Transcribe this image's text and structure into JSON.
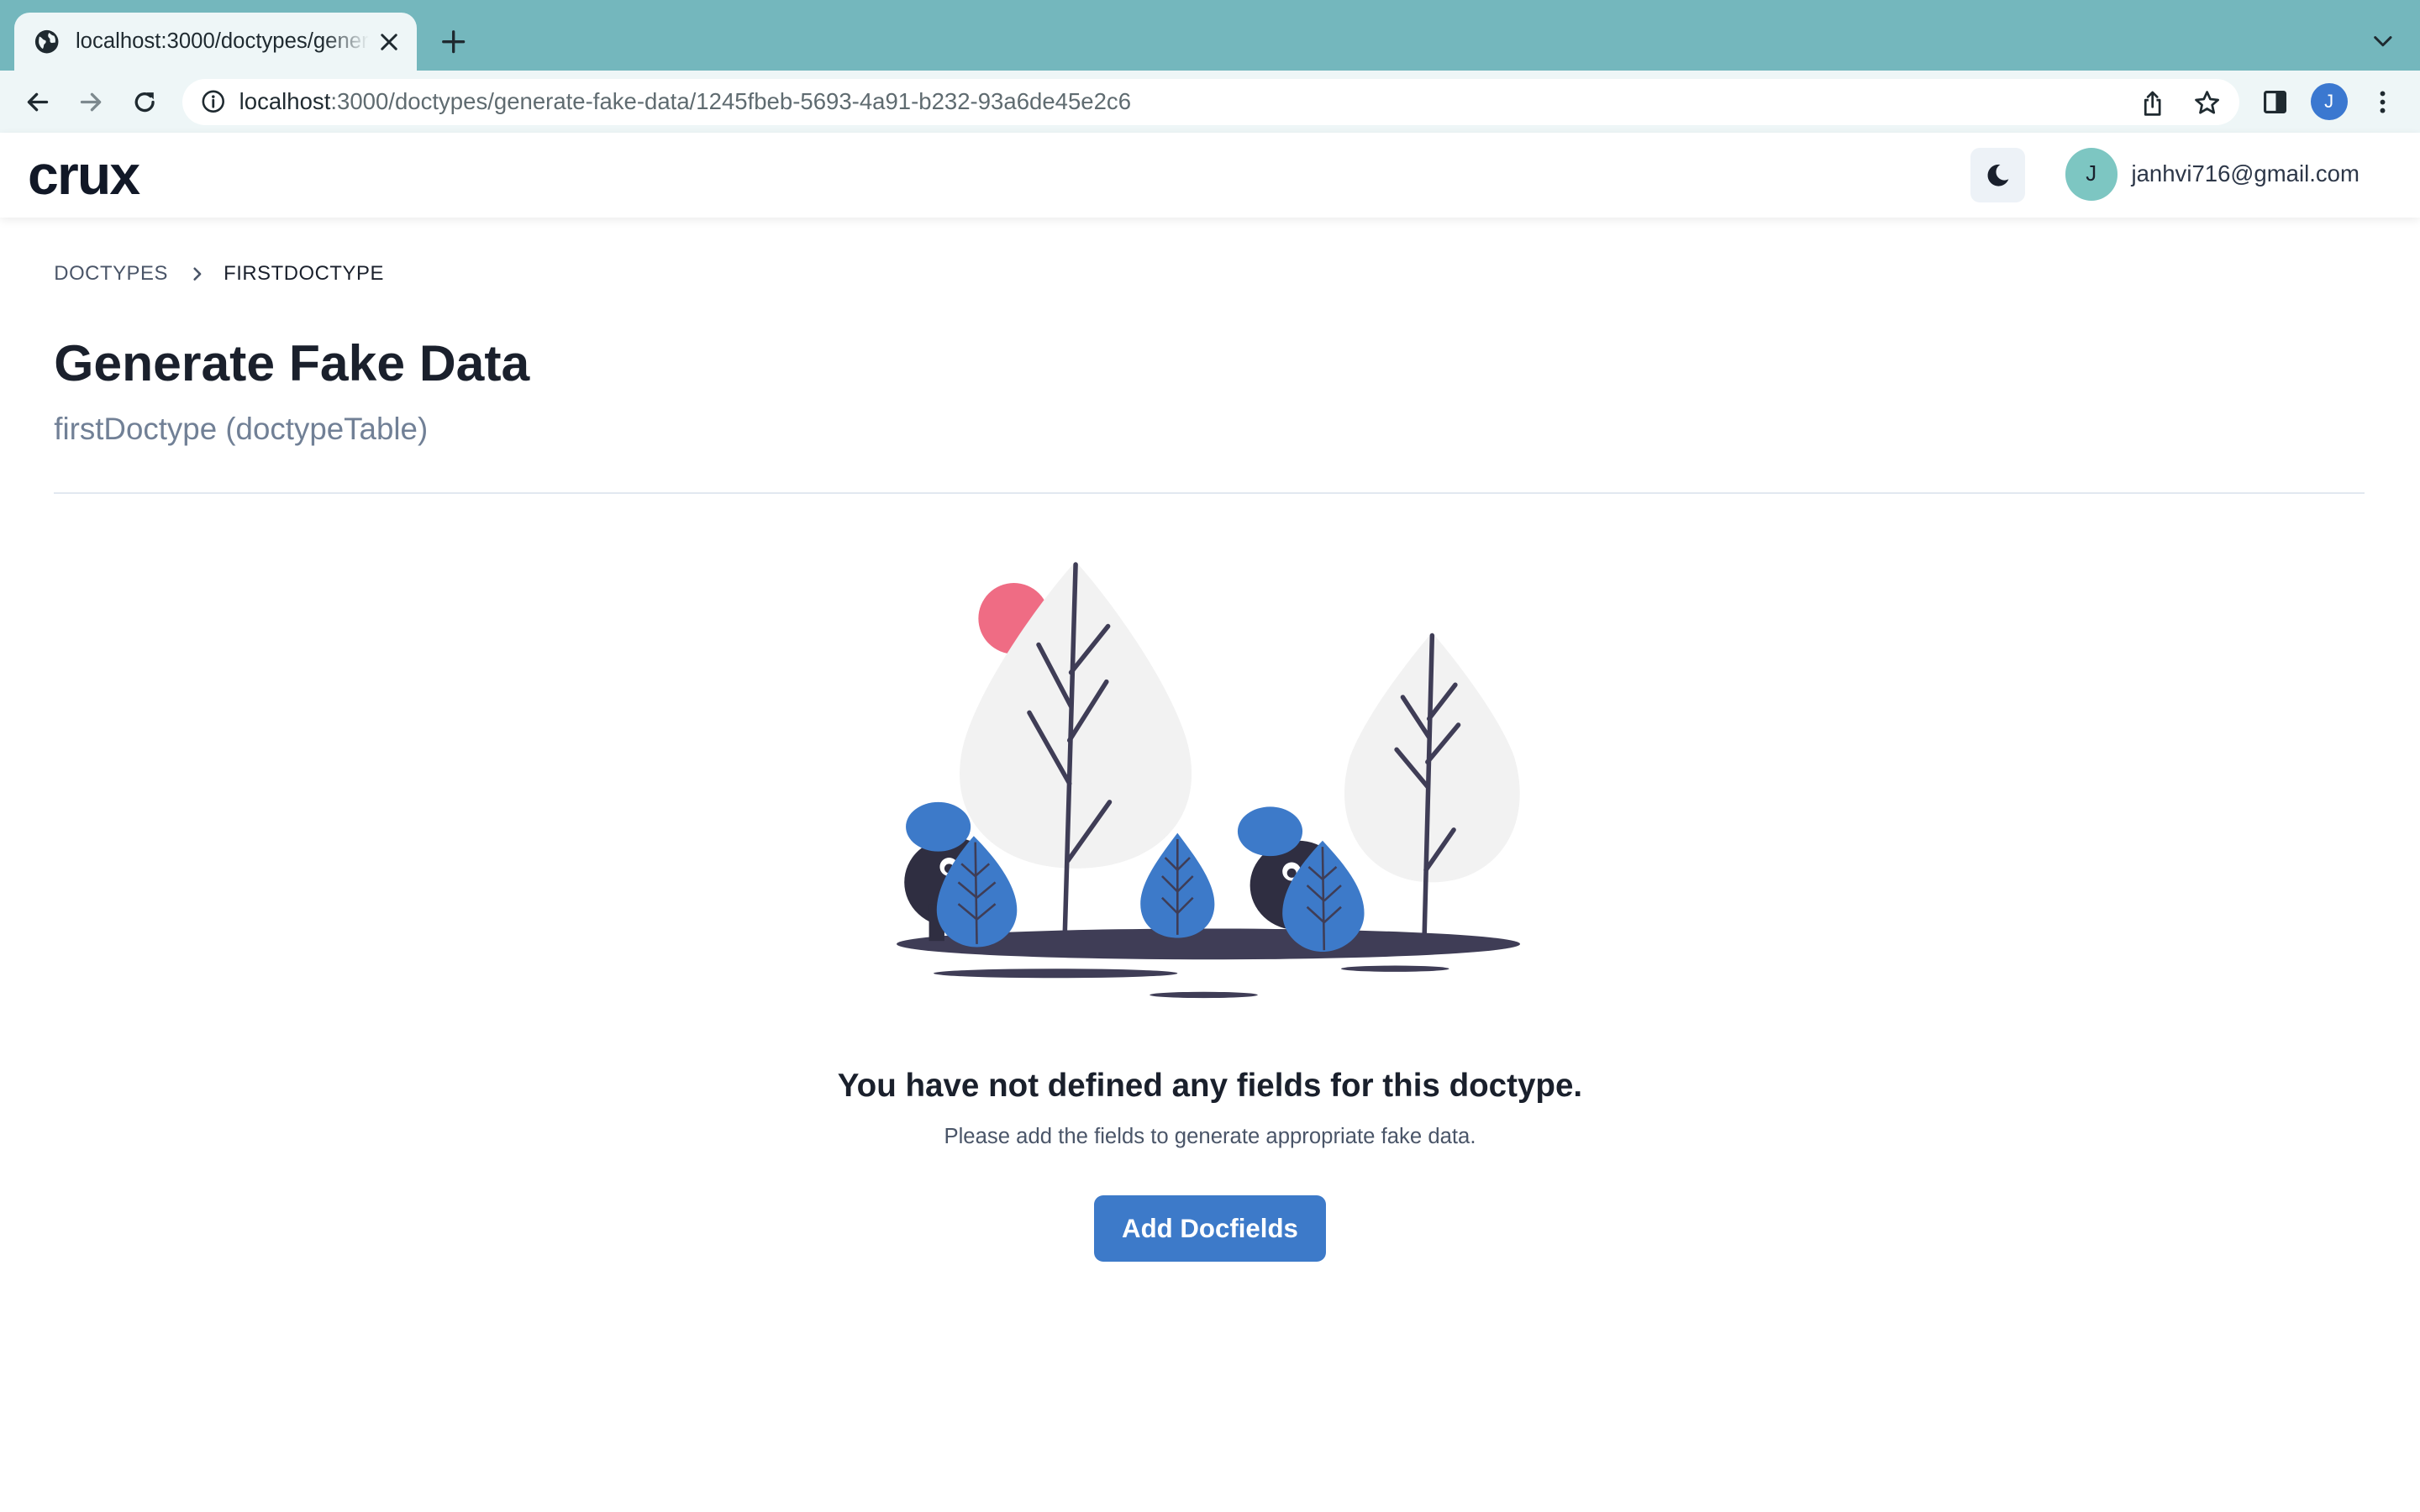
{
  "browser": {
    "tab_title": "localhost:3000/doctypes/generate-fake-data/1245fbeb-5693-4a91-b232-93a6de45e2c6",
    "url_host": "localhost",
    "url_rest": ":3000/doctypes/generate-fake-data/1245fbeb-5693-4a91-b232-93a6de45e2c6",
    "profile_initial": "J"
  },
  "header": {
    "logo": "crux",
    "user_initial": "J",
    "user_email": "janhvi716@gmail.com"
  },
  "breadcrumb": {
    "items": [
      "DOCTYPES",
      "FIRSTDOCTYPE"
    ]
  },
  "page": {
    "title": "Generate Fake Data",
    "subtitle": "firstDoctype (doctypeTable)"
  },
  "empty_state": {
    "title": "You have not defined any fields for this doctype.",
    "description": "Please add the fields to generate appropriate fake data.",
    "button_label": "Add Docfields"
  },
  "colors": {
    "chrome_tab_strip": "#74b7bd",
    "chrome_toolbar": "#eef6f7",
    "accent_blue": "#3d7ac9",
    "illustration_dark": "#3f3d56",
    "illustration_leaf": "#f2f2f2",
    "illustration_sun": "#ef6c84",
    "avatar_teal": "#7dc6c2"
  },
  "icons": {
    "favicon": "globe-icon",
    "tab_close": "close-icon",
    "new_tab": "plus-icon",
    "tab_search": "chevron-down-icon",
    "back": "arrow-left-icon",
    "forward": "arrow-right-icon",
    "reload": "reload-icon",
    "site_info": "info-icon",
    "share": "share-icon",
    "bookmark": "star-icon",
    "side_panel": "side-panel-icon",
    "menu": "kebab-menu-icon",
    "theme_toggle": "moon-icon",
    "breadcrumb_separator": "chevron-right-icon"
  }
}
